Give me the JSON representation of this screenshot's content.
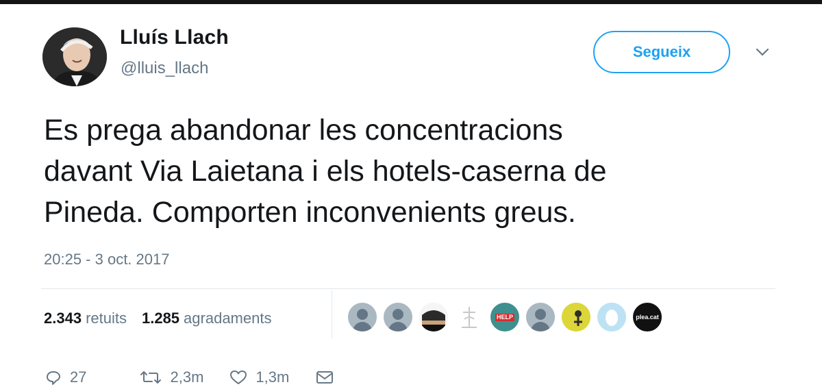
{
  "author": {
    "name": "Lluís Llach",
    "handle": "@lluis_llach"
  },
  "follow_button": {
    "label": "Segueix"
  },
  "tweet": {
    "lines": [
      "Es prega abandonar les concentracions",
      "davant Via Laietana i els hotels-caserna de",
      "Pineda. Comporten inconvenients greus."
    ],
    "timestamp": "20:25 - 3 oct. 2017"
  },
  "stats": {
    "retweets_count": "2.343",
    "retweets_label": "retuits",
    "likes_count": "1.285",
    "likes_label": "agradaments"
  },
  "likers": [
    {
      "type": "default"
    },
    {
      "type": "default"
    },
    {
      "type": "photo"
    },
    {
      "type": "sketch"
    },
    {
      "type": "logo",
      "text": "HELP"
    },
    {
      "type": "default"
    },
    {
      "type": "photo-yellow"
    },
    {
      "type": "egg"
    },
    {
      "type": "logo-dark",
      "text": "plea.cat"
    }
  ],
  "actions": {
    "replies": "27",
    "retweets": "2,3m",
    "likes": "1,3m"
  },
  "colors": {
    "accent": "#1da1f2",
    "secondary_text": "#657786",
    "primary_text": "#14171a"
  }
}
